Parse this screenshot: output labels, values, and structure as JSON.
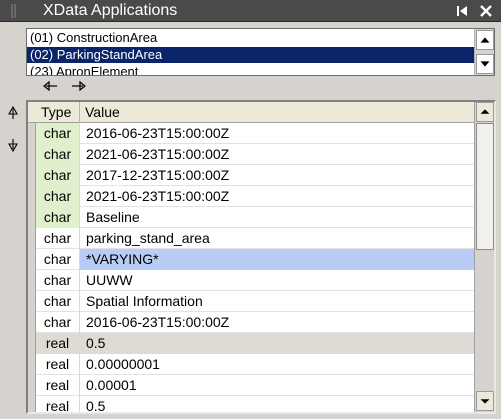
{
  "window": {
    "title": "XData Applications",
    "icons": [
      "grip-icon",
      "pin-icon",
      "close-icon"
    ]
  },
  "applications": {
    "items": [
      {
        "label": "(01) ConstructionArea",
        "selected": false
      },
      {
        "label": "(02) ParkingStandArea",
        "selected": true
      },
      {
        "label": "(23) ApronElement",
        "selected": false
      }
    ]
  },
  "grid": {
    "columns": [
      "Type",
      "Value"
    ],
    "rows": [
      {
        "type": "char",
        "value": "2016-06-23T15:00:00Z",
        "style": "green"
      },
      {
        "type": "char",
        "value": "2021-06-23T15:00:00Z",
        "style": "green"
      },
      {
        "type": "char",
        "value": "2017-12-23T15:00:00Z",
        "style": "green"
      },
      {
        "type": "char",
        "value": "2021-06-23T15:00:00Z",
        "style": "green"
      },
      {
        "type": "char",
        "value": "Baseline",
        "style": "green"
      },
      {
        "type": "char",
        "value": "parking_stand_area",
        "style": "normal"
      },
      {
        "type": "char",
        "value": "*VARYING*",
        "style": "highlight"
      },
      {
        "type": "char",
        "value": "UUWW",
        "style": "normal"
      },
      {
        "type": "char",
        "value": "Spatial Information",
        "style": "normal"
      },
      {
        "type": "char",
        "value": "2016-06-23T15:00:00Z",
        "style": "normal"
      },
      {
        "type": "real",
        "value": "0.5",
        "style": "gray"
      },
      {
        "type": "real",
        "value": "0.00000001",
        "style": "normal"
      },
      {
        "type": "real",
        "value": "0.00001",
        "style": "normal"
      },
      {
        "type": "real",
        "value": "0.5",
        "style": "normal"
      }
    ]
  },
  "colors": {
    "titlebar": "#4a4a4a",
    "selection": "#0a246a",
    "type_green": "#e1f0cc",
    "highlight": "#b7cdf5",
    "gray_row": "#dedad4"
  }
}
